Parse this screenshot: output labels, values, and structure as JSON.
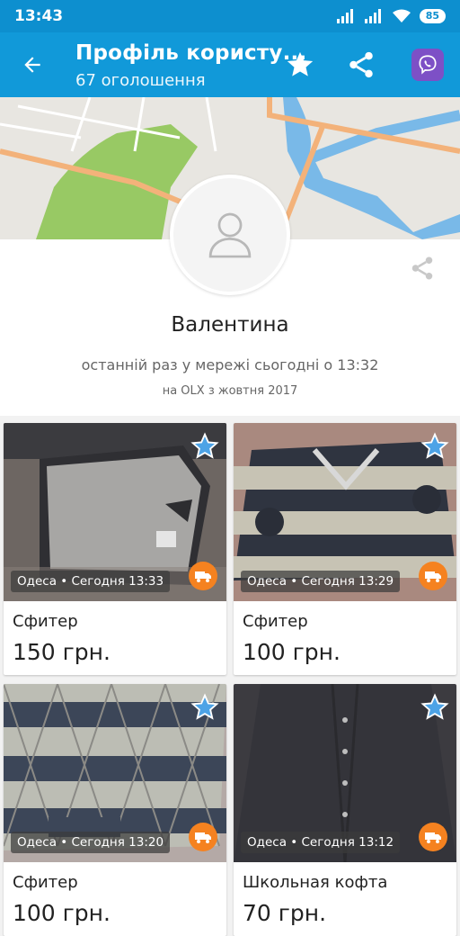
{
  "status_bar": {
    "time": "13:43",
    "battery": "85"
  },
  "app_bar": {
    "title": "Профіль користу...",
    "subtitle": "67 оголошення"
  },
  "profile": {
    "name": "Валентина",
    "last_seen": "останній раз у мережі сьогодні о 13:32",
    "member_since": "на OLX з жовтня 2017"
  },
  "listings": [
    {
      "location": "Одеса • Сегодня 13:33",
      "title": "Сфитер",
      "price": "150 грн."
    },
    {
      "location": "Одеса • Сегодня 13:29",
      "title": "Сфитер",
      "price": "100 грн."
    },
    {
      "location": "Одеса • Сегодня 13:20",
      "title": "Сфитер",
      "price": "100 грн."
    },
    {
      "location": "Одеса • Сегодня 13:12",
      "title": "Школьная кофта",
      "price": "70 грн."
    }
  ],
  "colors": {
    "app_bar": "#1199d9",
    "status_bar": "#0d8fcf",
    "delivery_badge": "#f58220",
    "viber": "#7d50c6"
  },
  "icons": [
    "back-arrow-icon",
    "star-icon",
    "share-icon",
    "viber-icon",
    "avatar-placeholder-icon",
    "delivery-truck-icon"
  ]
}
